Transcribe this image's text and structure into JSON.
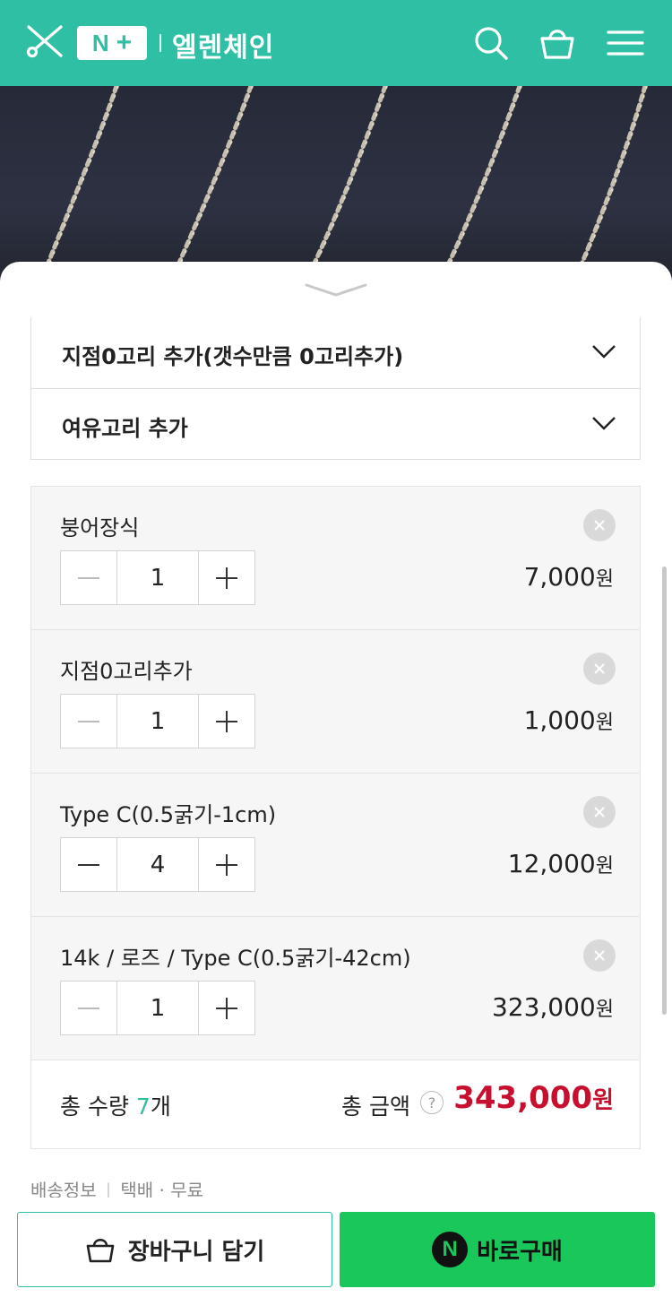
{
  "header": {
    "badge_n": "N",
    "badge_plus": "+",
    "store_name": "엘렌체인",
    "brand_color": "#2fbfa5",
    "icons": [
      "scissors-logo-icon",
      "search-icon",
      "shopping-bag-icon",
      "hamburger-menu-icon"
    ]
  },
  "options": [
    {
      "label": "지점0고리 추가(갯수만큼 0고리추가)"
    },
    {
      "label": "여유고리 추가"
    }
  ],
  "items": [
    {
      "name": "붕어장식",
      "qty": "1",
      "price": "7,000",
      "unit": "원"
    },
    {
      "name": "지점0고리추가",
      "qty": "1",
      "price": "1,000",
      "unit": "원"
    },
    {
      "name": "Type C(0.5굵기-1cm)",
      "qty": "4",
      "price": "12,000",
      "unit": "원"
    },
    {
      "name": "14k / 로즈 / Type C(0.5굵기-42cm)",
      "qty": "1",
      "price": "323,000",
      "unit": "원"
    }
  ],
  "summary": {
    "qty_label": "총 수량",
    "qty_value": "7",
    "qty_unit": "개",
    "amount_label": "총 금액",
    "help": "?",
    "total": "343,000",
    "total_unit": "원",
    "total_color": "#c8102e"
  },
  "shipping": {
    "label": "배송정보",
    "method": "택배 · 무료"
  },
  "bottom": {
    "cart_label": "장바구니 담기",
    "buy_label": "바로구매",
    "npay_badge": "N",
    "buy_color": "#19c75a"
  }
}
